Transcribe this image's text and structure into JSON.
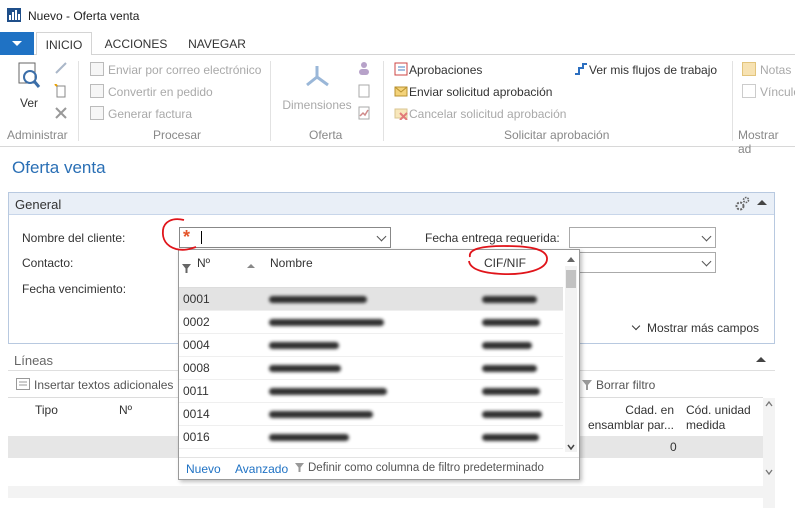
{
  "window": {
    "title": "Nuevo - Oferta venta"
  },
  "tabs": [
    {
      "label": "INICIO"
    },
    {
      "label": "ACCIONES"
    },
    {
      "label": "NAVEGAR"
    }
  ],
  "ribbon": {
    "administrar": {
      "label": "Administrar",
      "ver": "Ver"
    },
    "procesar": {
      "label": "Procesar",
      "enviar_correo": "Enviar por correo electrónico",
      "convertir_pedido": "Convertir en pedido",
      "generar_factura": "Generar factura"
    },
    "oferta": {
      "label": "Oferta",
      "dimensiones": "Dimensiones"
    },
    "solicitar": {
      "label": "Solicitar aprobación",
      "aprobaciones": "Aprobaciones",
      "enviar_solicitud": "Enviar solicitud aprobación",
      "cancelar_solicitud": "Cancelar solicitud aprobación",
      "ver_flujos": "Ver mis flujos de trabajo"
    },
    "mostrar": {
      "label": "Mostrar ad",
      "notas": "Notas",
      "vinculos": "Vínculo"
    }
  },
  "page": {
    "title": "Oferta venta"
  },
  "general": {
    "title": "General",
    "nombre_cliente": "Nombre del cliente:",
    "contacto": "Contacto:",
    "fecha_vencimiento": "Fecha vencimiento:",
    "fecha_entrega": "Fecha entrega requerida:",
    "mostrar_mas": "Mostrar más campos",
    "required_mark": "*"
  },
  "lineas": {
    "title": "Líneas",
    "insertar": "Insertar textos adicionales",
    "borrar_filtro": "Borrar filtro",
    "columns": {
      "tipo": "Tipo",
      "no": "Nº",
      "cdad_ensamblar_1": "Cdad. en",
      "cdad_ensamblar_2": "ensamblar par...",
      "cod_unidad_1": "Cód. unidad",
      "cod_unidad_2": "medida"
    },
    "row_value": "0"
  },
  "lookup": {
    "columns": {
      "no": "Nº",
      "nombre": "Nombre",
      "cif": "CIF/NIF"
    },
    "rows": [
      {
        "no": "0001"
      },
      {
        "no": "0002"
      },
      {
        "no": "0004"
      },
      {
        "no": "0008"
      },
      {
        "no": "0011"
      },
      {
        "no": "0014"
      },
      {
        "no": "0016"
      }
    ],
    "footer": {
      "nuevo": "Nuevo",
      "avanzado": "Avanzado",
      "definir": "Definir como columna de filtro predeterminado"
    }
  },
  "colors": {
    "accent": "#1f72c4",
    "title_blue": "#2a6fb5",
    "annotation": "#e0141a"
  }
}
